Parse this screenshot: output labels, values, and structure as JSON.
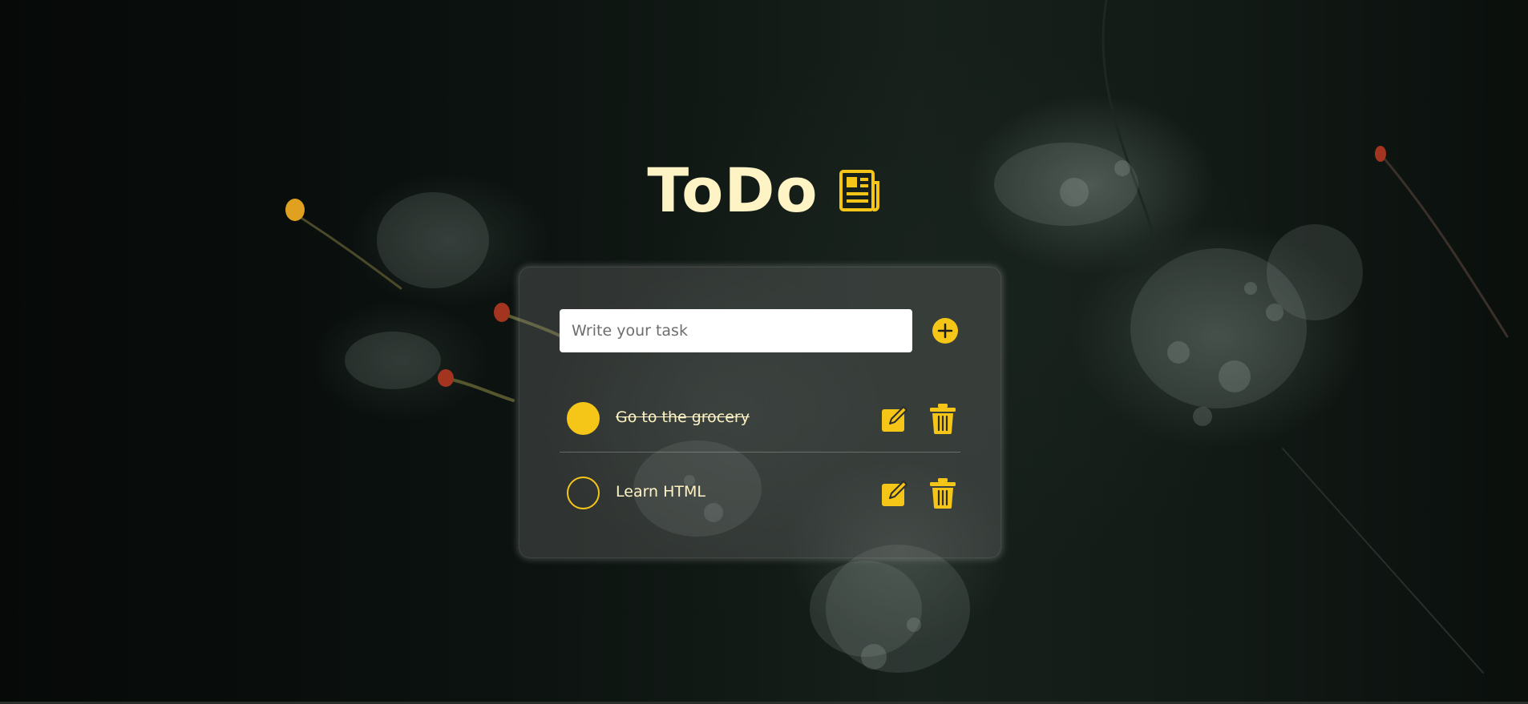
{
  "app": {
    "title": "ToDo",
    "title_icon": "newspaper-icon"
  },
  "input": {
    "placeholder": "Write your task",
    "value": ""
  },
  "add_button": {
    "icon": "plus-circle-icon"
  },
  "tasks": [
    {
      "text": "Go to the grocery",
      "completed": true
    },
    {
      "text": "Learn HTML",
      "completed": false
    }
  ],
  "task_actions": {
    "edit_icon": "edit-icon",
    "delete_icon": "trash-icon"
  },
  "colors": {
    "accent": "#f5c518",
    "title_text": "#fdf3c4",
    "task_text": "#fdf3c4",
    "input_background": "#ffffff"
  }
}
